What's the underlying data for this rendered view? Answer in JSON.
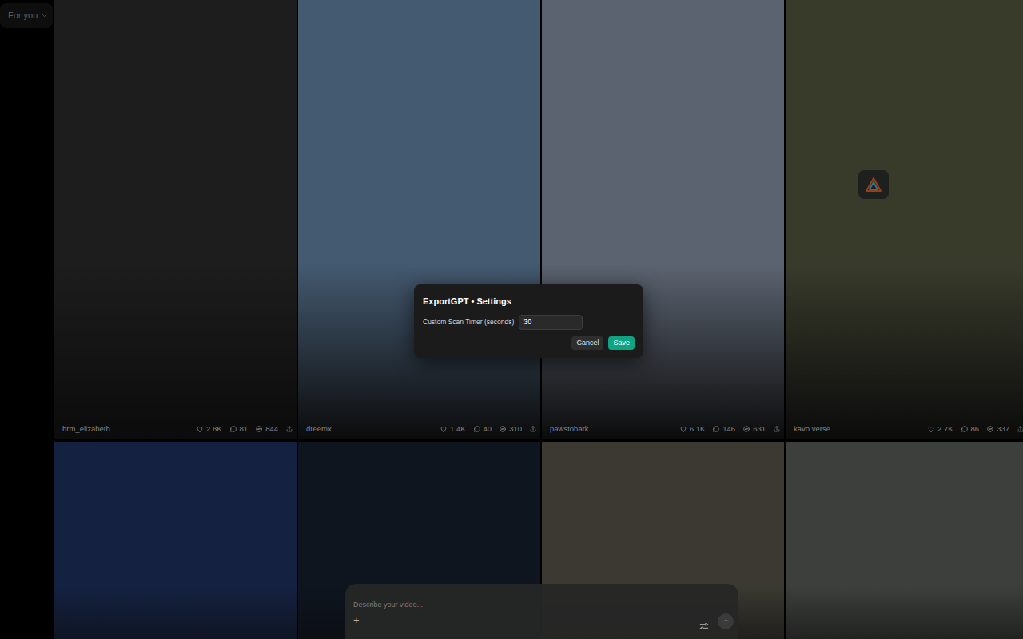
{
  "feed_selector": {
    "label": "For you"
  },
  "tiles": [
    {
      "user": "hrm_elizabeth",
      "likes": "2.8K",
      "comments": "81",
      "remixes": "844",
      "color": "#2b2b2b",
      "badge": false
    },
    {
      "user": "dreemx",
      "likes": "1.4K",
      "comments": "40",
      "remixes": "310",
      "color": "#6585a6",
      "badge": false
    },
    {
      "user": "pawstobark",
      "likes": "6.1K",
      "comments": "146",
      "remixes": "631",
      "color": "#8793a6",
      "badge": false
    },
    {
      "user": "kavo.verse",
      "likes": "2.7K",
      "comments": "86",
      "remixes": "337",
      "color": "#53563f",
      "badge": true
    },
    {
      "color": "#1e3260",
      "badge": false
    },
    {
      "color": "#151f2e",
      "badge": false
    },
    {
      "color": "#57554a",
      "badge": false
    },
    {
      "color": "#5a5e5a",
      "badge": false
    }
  ],
  "modal": {
    "title": "ExportGPT • Settings",
    "field_label": "Custom Scan Timer (seconds)",
    "field_value": "30",
    "buttons": [
      {
        "label": "Cancel"
      },
      {
        "label": "Save"
      }
    ]
  },
  "prompt": {
    "placeholder": "Describe your video...",
    "add_button": "+"
  }
}
